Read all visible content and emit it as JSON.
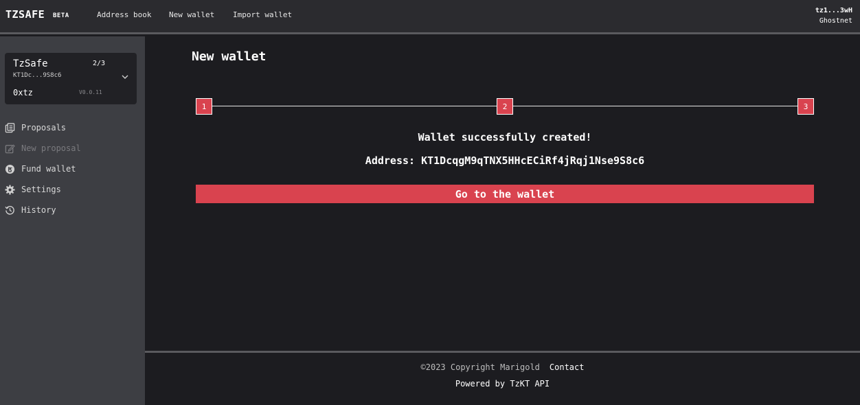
{
  "header": {
    "brand": "TZSAFE",
    "badge": "BETA",
    "nav": {
      "address_book": "Address book",
      "new_wallet": "New wallet",
      "import_wallet": "Import wallet"
    },
    "account": {
      "address": "tz1...3wH",
      "network": "Ghostnet"
    }
  },
  "sidebar": {
    "wallet": {
      "name": "TzSafe",
      "threshold": "2/3",
      "address": "KT1Dc...9S8c6",
      "balance": "0xtz",
      "version": "V0.0.11"
    },
    "items": [
      {
        "label": "Proposals",
        "icon": "proposals-icon",
        "disabled": false
      },
      {
        "label": "New proposal",
        "icon": "pencil-icon",
        "disabled": true
      },
      {
        "label": "Fund wallet",
        "icon": "tezos-coin-icon",
        "disabled": false
      },
      {
        "label": "Settings",
        "icon": "gear-icon",
        "disabled": false
      },
      {
        "label": "History",
        "icon": "history-icon",
        "disabled": false
      }
    ]
  },
  "main": {
    "title": "New wallet",
    "steps": [
      "1",
      "2",
      "3"
    ],
    "success_message": "Wallet successfully created!",
    "address_line": "Address: KT1DcqgM9qTNX5HHcECiRf4jRqj1Nse9S8c6",
    "go_button": "Go to the wallet"
  },
  "footer": {
    "copyright": "©2023 Copyright Marigold",
    "contact": "Contact",
    "powered_by": "Powered by TzKT API"
  },
  "colors": {
    "accent": "#d9434f",
    "background": "#1c1c20",
    "sidebar": "#3d3e43",
    "header": "#2b2b2f"
  }
}
